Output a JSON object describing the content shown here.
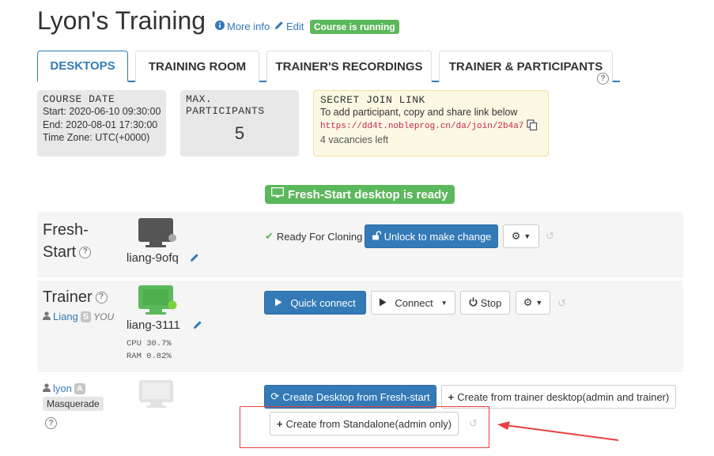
{
  "header": {
    "title": "Lyon's Training",
    "more_info": "More info",
    "edit": "Edit",
    "status_badge": "Course is running"
  },
  "tabs": [
    {
      "label": "DESKTOPS",
      "active": true
    },
    {
      "label": "TRAINING ROOM"
    },
    {
      "label": "TRAINER'S RECORDINGS"
    },
    {
      "label": "TRAINER & PARTICIPANTS"
    }
  ],
  "course_date": {
    "title": "COURSE DATE",
    "start": "Start: 2020-06-10 09:30:00",
    "end": "End: 2020-08-01 17:30:00",
    "timezone": "Time Zone: UTC(+0000)"
  },
  "max_participants": {
    "title": "MAX. PARTICIPANTS",
    "value": "5"
  },
  "secret_link": {
    "title": "SECRET JOIN LINK",
    "description": "To add participant, copy and share link below",
    "url": "https://dd4t.nobleprog.cn/da/join/2b4a7",
    "vacancies": "4 vacancies left"
  },
  "ready_banner": "Fresh-Start desktop is ready",
  "rows": {
    "fresh_start": {
      "label_line1": "Fresh-",
      "label_line2": "Start",
      "machine": "liang-9ofq",
      "status": "Ready For Cloning",
      "unlock_button": "Unlock to make change"
    },
    "trainer": {
      "label": "Trainer",
      "user": "Liang",
      "user_badge": "S",
      "you": "YOU",
      "machine": "liang-3111",
      "cpu": "CPU 30.7%",
      "ram": "RAM 0.82%",
      "quick_connect": "Quick connect",
      "connect": "Connect",
      "stop": "Stop"
    },
    "participant": {
      "user": "lyon",
      "user_badge": "A",
      "masquerade": "Masquerade",
      "create_fresh": "Create Desktop from Fresh-start",
      "create_trainer": "Create from trainer desktop(admin and trainer)",
      "create_standalone": "Create from Standalone(admin only)"
    }
  },
  "colors": {
    "primary": "#337ab7",
    "success": "#5cb85c",
    "annotation_red": "#e84040",
    "online_green": "#7cd23c"
  }
}
